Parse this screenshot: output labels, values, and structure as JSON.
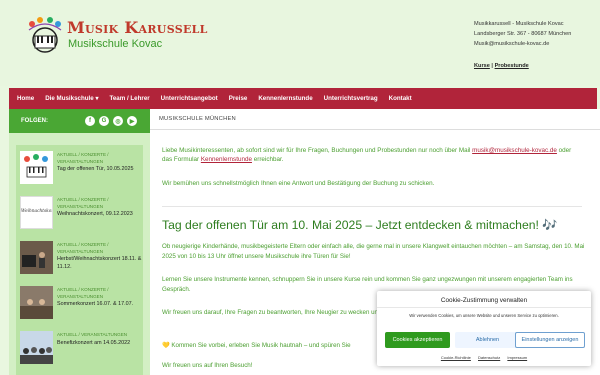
{
  "header": {
    "logo_title": "Musik Karussell",
    "logo_subtitle": "Musikschule Kovac",
    "contact_name": "Musikkarussell - Musikschule Kovac",
    "contact_address": "Landsberger Str. 367 - 80687 München",
    "contact_email": "Musik@musikschule-kovac.de",
    "link_kurse": "Kurse",
    "link_separator": "|",
    "link_probestunde": "Probestunde"
  },
  "nav": {
    "items": [
      "Home",
      "Die Musikschule",
      "Team / Lehrer",
      "Unterrichtsangebot",
      "Preise",
      "Kennenlernstunde",
      "Unterrichtsvertrag",
      "Kontakt"
    ]
  },
  "sidebar": {
    "follow_label": "FOLGEN:",
    "social_icons": [
      "facebook-icon",
      "google-icon",
      "instagram-icon",
      "youtube-icon"
    ],
    "posts": [
      {
        "meta": "AKTUELL / KONZERTE / VERANSTALTUNGEN",
        "title": "Tag der offenen Tür, 10.05.2025"
      },
      {
        "meta": "AKTUELL / KONZERTE / VERANSTALTUNGEN",
        "title": "Weihnachtskonzert, 09.12.2023",
        "thumb_text": "Weihnachtskonzert"
      },
      {
        "meta": "AKTUELL / KONZERTE / VERANSTALTUNGEN",
        "title": "Herbst/Weihnachtskonzert 18.11. & 11.12."
      },
      {
        "meta": "AKTUELL / KONZERTE / VERANSTALTUNGEN",
        "title": "Sommerkonzert 16.07. & 17.07."
      },
      {
        "meta": "AKTUELL / VERANSTALTUNGEN",
        "title": "Benefizkonzert am 14.05.2022"
      }
    ]
  },
  "main": {
    "breadcrumb": "MUSIKSCHULE MÜNCHEN",
    "intro_a": "Liebe Musikinteressenten, ab sofort sind wir für Ihre Fragen, Buchungen und Probestunden nur noch über Mail",
    "intro_email": "musik@musikschule-kovac.de",
    "intro_b": "oder das Formular",
    "intro_link": "Kennenlernstunde",
    "intro_c": "erreichbar.",
    "intro2": "Wir bemühen uns schnellstmöglich Ihnen eine Antwort und Bestätigung der Buchung zu schicken.",
    "heading": "Tag der offenen Tür am 10. Mai 2025 – Jetzt entdecken & mitmachen! 🎶",
    "p1": "Ob neugierige Kinderhände, musikbegeisterte Eltern oder einfach alle, die gerne mal in unsere Klangwelt eintauchen möchten – am Samstag, den 10. Mai 2025 von 10 bis 13 Uhr öffnet unsere Musikschule ihre Türen für Sie!",
    "p2": "Lernen Sie unsere Instrumente kennen, schnuppern Sie in unsere Kurse rein und kommen Sie ganz ungezwungen mit unserem engagierten Team ins Gespräch.",
    "p3": "Wir freuen uns darauf, Ihre Fragen zu beantworten, Ihre Neugier zu wecken und gemeinsam mit Ihnen die Freude am Musizieren zu entfachen.",
    "p4": "💛 Kommen Sie vorbei, erleben Sie Musik hautnah – und spüren Sie",
    "p5": "Wir freuen uns auf Ihren Besuch!"
  },
  "cookie": {
    "title": "Cookie-Zustimmung verwalten",
    "text": "Wir verwenden Cookies, um unsere Website und unseren Service zu optimieren.",
    "accept": "Cookies akzeptieren",
    "reject": "Ablehnen",
    "settings": "Einstellungen anzeigen",
    "link1": "Cookie-Richtlinie",
    "link2": "Datenschutz",
    "link3": "Impressum"
  },
  "colors": {
    "nav_red": "#b1243a",
    "green": "#4aa734",
    "background": "#e9f7e0"
  }
}
